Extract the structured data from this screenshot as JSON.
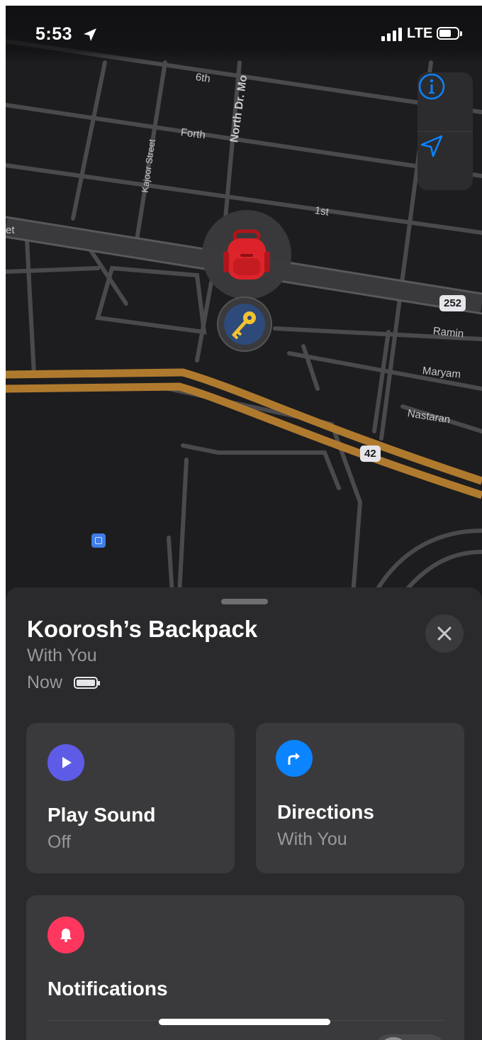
{
  "status_bar": {
    "time": "5:53",
    "network": "LTE"
  },
  "map": {
    "streets": [
      {
        "label": "6th"
      },
      {
        "label": "North Dr. Mo"
      },
      {
        "label": "Forth"
      },
      {
        "label": "Kajoor Street"
      },
      {
        "label": "1st"
      },
      {
        "label": "et"
      },
      {
        "label": "Ramin"
      },
      {
        "label": "Maryam"
      },
      {
        "label": "Nastaran"
      }
    ],
    "route_shields": [
      "252",
      "42"
    ],
    "colors": {
      "highway": "#b07a2e",
      "road": "#4a4a4d",
      "background": "#1d1d1f"
    }
  },
  "item": {
    "name": "Koorosh’s Backpack",
    "status": "With You",
    "last_seen": "Now"
  },
  "actions": {
    "play_sound": {
      "title": "Play Sound",
      "subtitle": "Off",
      "color": "#5e5ce6"
    },
    "directions": {
      "title": "Directions",
      "subtitle": "With You",
      "color": "#0a84ff"
    },
    "notifications": {
      "title": "Notifications",
      "color": "#ff375f"
    }
  }
}
